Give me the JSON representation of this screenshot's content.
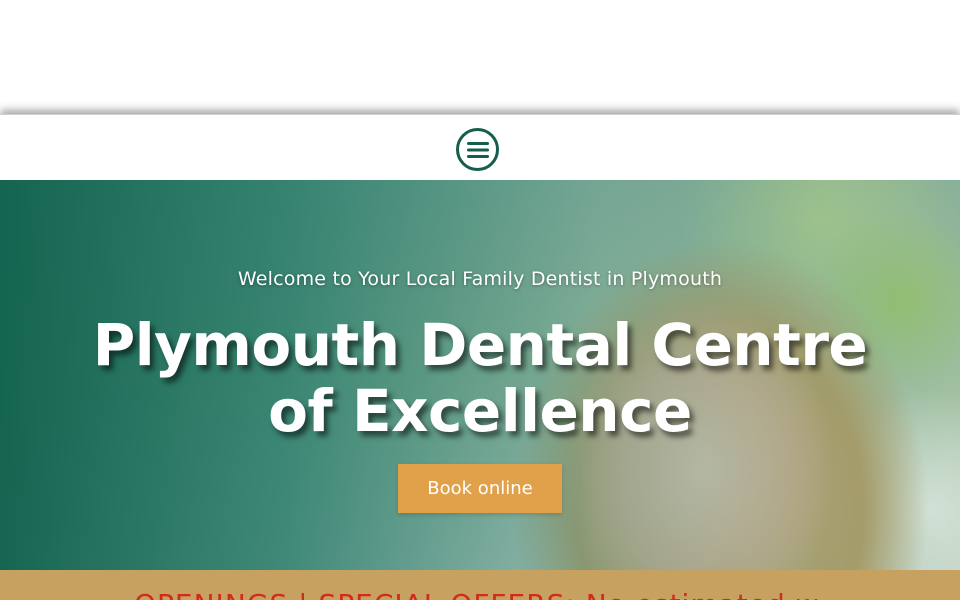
{
  "header": {
    "menu_icon": "hamburger-menu-icon",
    "accent_color": "#155e4e"
  },
  "hero": {
    "subtitle": "Welcome to Your Local Family Dentist in Plymouth",
    "title": "Plymouth Dental Centre of Excellence",
    "book_button_label": "Book online",
    "button_color": "#e0a14a"
  },
  "announcement": {
    "text": "OPENINGS | SPECIAL OFFERS: No estimated w",
    "text_color": "#d22a1f",
    "background": "#c6a15f"
  }
}
